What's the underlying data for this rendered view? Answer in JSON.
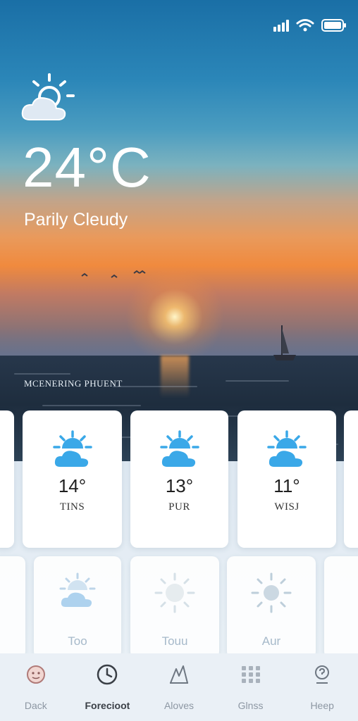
{
  "current": {
    "temperature": "24°C",
    "condition": "Parily Cleudy",
    "location": "MCENERING PHUENT"
  },
  "forecast_cards": [
    {
      "temp": "14°",
      "label": "TINS",
      "icon": "partly-cloudy-icon"
    },
    {
      "temp": "13°",
      "label": "PUR",
      "icon": "partly-cloudy-icon"
    },
    {
      "temp": "11°",
      "label": "WISJ",
      "icon": "partly-cloudy-icon"
    }
  ],
  "secondary_cards": [
    {
      "label": "Too",
      "icon": "partly-cloudy-icon"
    },
    {
      "label": "Touu",
      "icon": "sun-icon"
    },
    {
      "label": "Aur",
      "icon": "sun-icon"
    }
  ],
  "nav": [
    {
      "label": "Dack",
      "icon": "face-icon",
      "active": false
    },
    {
      "label": "Forecioot",
      "icon": "clock-icon",
      "active": true
    },
    {
      "label": "Aloves",
      "icon": "chart-icon",
      "active": false
    },
    {
      "label": "Glnss",
      "icon": "grid-icon",
      "active": false
    },
    {
      "label": "Heep",
      "icon": "help-icon",
      "active": false
    }
  ],
  "colors": {
    "accent_blue": "#3aa8e8",
    "sky_top": "#1a6fa6",
    "sunset_orange": "#f08a3e"
  }
}
